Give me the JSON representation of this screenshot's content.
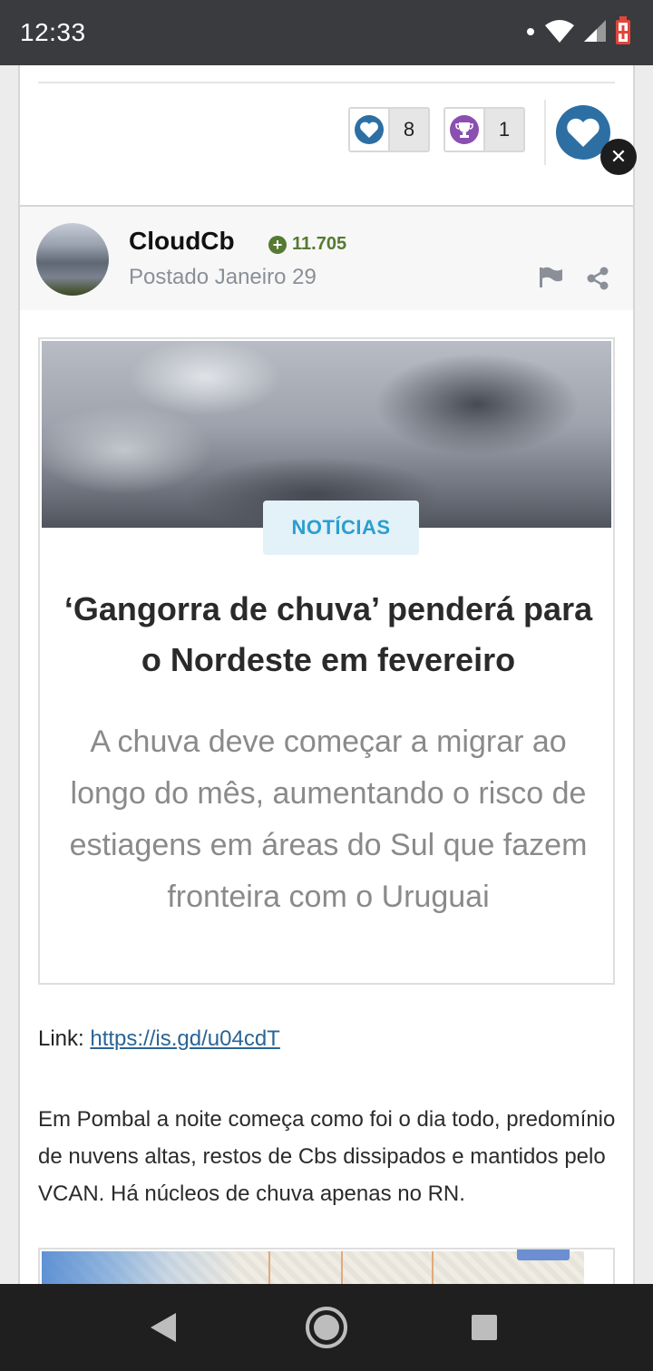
{
  "status_bar": {
    "time": "12:33"
  },
  "reactions": {
    "like_count": "8",
    "trophy_count": "1"
  },
  "close_symbol": "✕",
  "post": {
    "author": "CloudCb",
    "reputation": "11.705",
    "reputation_sign": "+",
    "posted": "Postado Janeiro 29",
    "embed": {
      "tag": "NOTÍCIAS",
      "headline": "‘Gangorra de chuva’ penderá para o Nordeste em fevereiro",
      "subheadline": "A chuva deve começar a migrar ao longo do mês, aumentando o risco de estiagens em áreas do Sul que fazem fronteira com o Uruguai"
    },
    "link_label": "Link: ",
    "link_url": "https://is.gd/u04cdT",
    "body": "Em Pombal a noite começa como foi o dia todo, predomínio de nuvens altas, restos de Cbs dissipados e mantidos pelo VCAN. Há núcleos de chuva apenas no RN."
  },
  "colors": {
    "like_blue": "#2d6fa3",
    "trophy_purple": "#8a4fb0",
    "rep_green": "#557a31",
    "tag_blue": "#2a9fd0",
    "link_blue": "#2a6496"
  },
  "icons": {
    "status": [
      "wifi-icon",
      "signal-icon",
      "battery-icon"
    ],
    "post_actions": [
      "flag-icon",
      "share-icon"
    ],
    "nav": [
      "back-icon",
      "home-icon",
      "recents-icon"
    ]
  }
}
